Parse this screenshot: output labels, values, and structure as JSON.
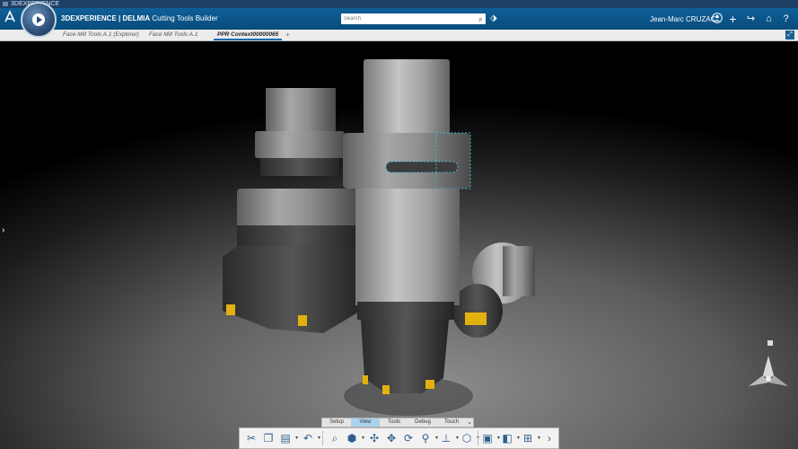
{
  "window": {
    "title": "3DEXPERIENCE"
  },
  "header": {
    "brand_prefix": "3DEXPERIENCE | ",
    "brand_company": "DELMIA",
    "brand_app": " Cutting Tools Builder",
    "search_placeholder": "Search",
    "user_name": "Jean-Marc CRUZAC"
  },
  "tabs": [
    {
      "label": "Face Mill Tools A.1 (Explorer)"
    },
    {
      "label": "Face Mill Tools A.1"
    },
    {
      "label": "PPR Context00000065"
    }
  ],
  "ribbon": {
    "tabs": [
      {
        "label": "Setup"
      },
      {
        "label": "View"
      },
      {
        "label": "Tools"
      },
      {
        "label": "Debug"
      },
      {
        "label": "Touch"
      }
    ],
    "active_tab": "View"
  },
  "colors": {
    "header_blue": "#0a5588",
    "active_tab_blue": "#aad2ee",
    "insert_gold": "#e3b10e"
  }
}
